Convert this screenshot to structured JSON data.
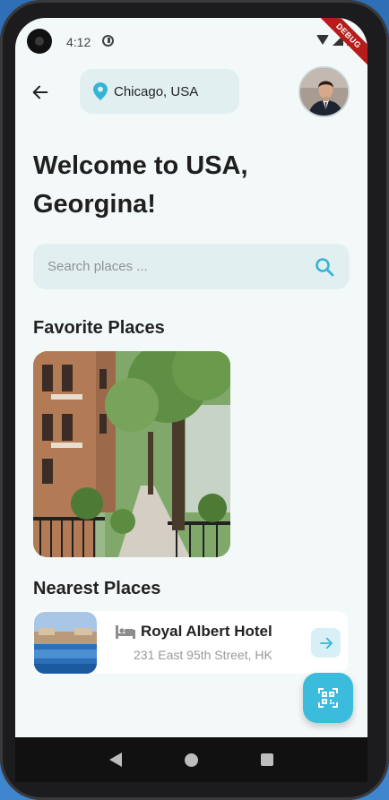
{
  "status_bar": {
    "time": "4:12",
    "debug_banner": "DEBUG"
  },
  "header": {
    "location": "Chicago, USA"
  },
  "greeting": {
    "line1": "Welcome to USA,",
    "line2": "Georgina!"
  },
  "search": {
    "placeholder": "Search places ...",
    "value": ""
  },
  "favorites": {
    "title": "Favorite Places"
  },
  "nearest": {
    "title": "Nearest Places",
    "items": [
      {
        "name": "Royal Albert Hotel",
        "address": "231 East 95th Street, HK"
      }
    ]
  },
  "colors": {
    "accent": "#3cbcdc",
    "background": "#f3f9f9",
    "chip": "#e1eff1"
  },
  "icons": [
    "back-arrow-icon",
    "location-pin-icon",
    "search-icon",
    "bed-icon",
    "arrow-right-icon",
    "qr-scan-icon"
  ]
}
